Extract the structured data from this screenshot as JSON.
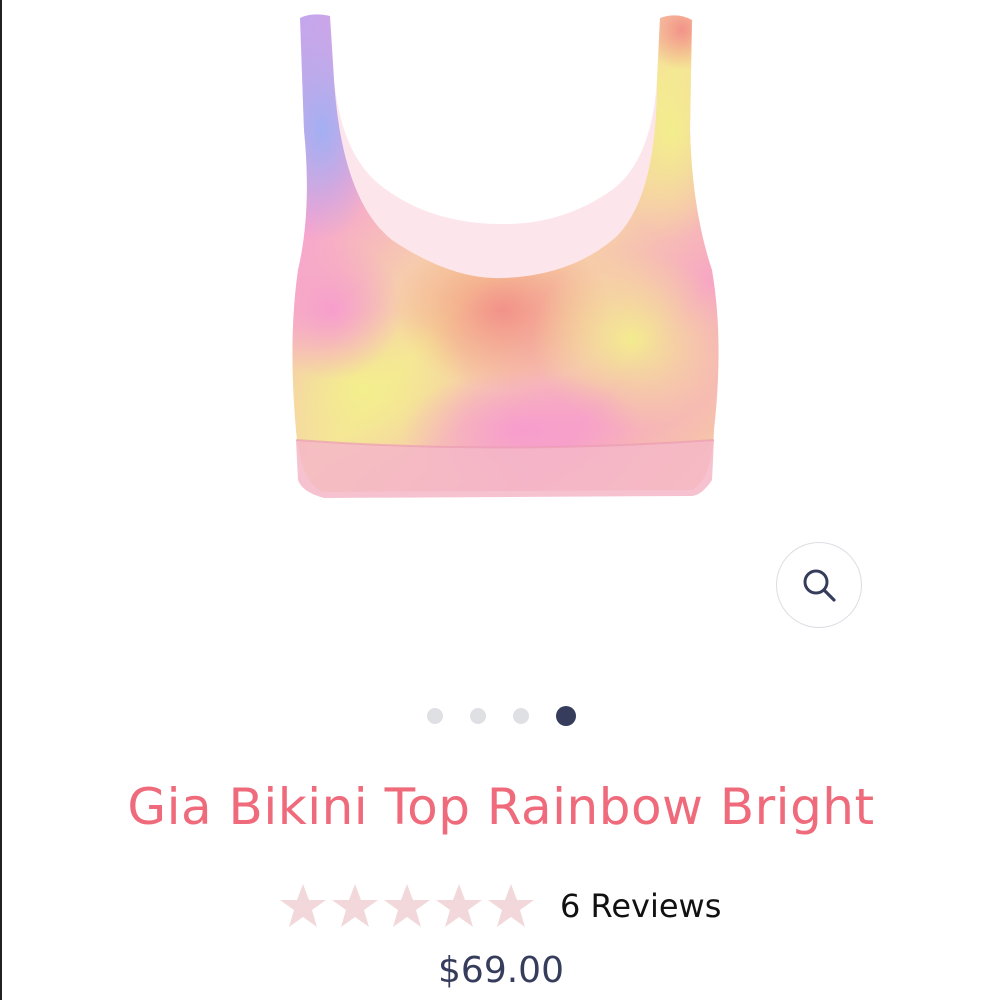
{
  "product": {
    "title": "Gia Bikini Top Rainbow Bright",
    "reviews_label": "6 Reviews",
    "rating_stars": 5,
    "price": "$69.00",
    "image_alt": "bikini-top-tie-dye"
  },
  "gallery": {
    "total_slides": 4,
    "active_slide": 4
  },
  "icons": {
    "zoom": "magnifier-icon",
    "star": "star-icon"
  },
  "colors": {
    "title": "#ef6b7c",
    "price": "#363d5c",
    "star": "#f2d8da",
    "dot_active": "#363d5c",
    "dot_inactive": "#dfe0e4"
  }
}
